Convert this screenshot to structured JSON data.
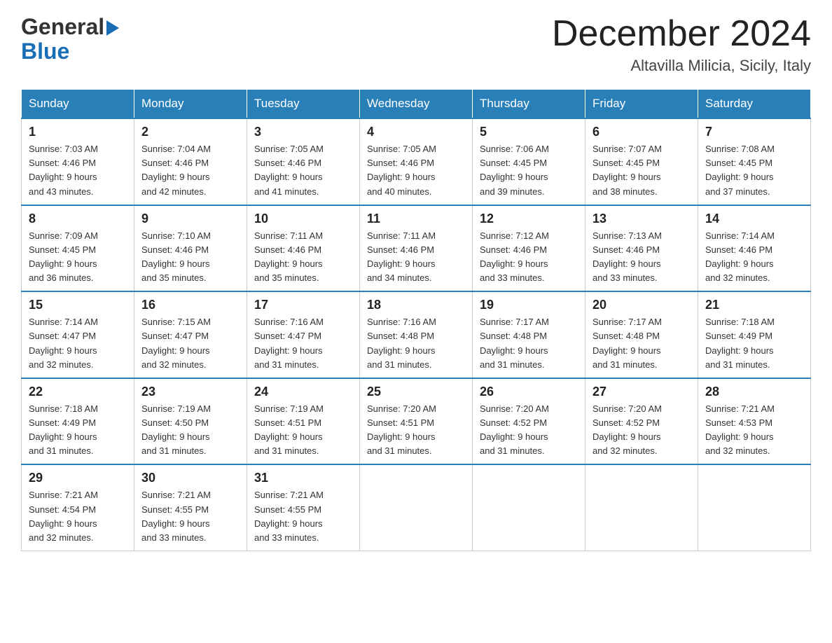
{
  "header": {
    "logo_general": "General",
    "logo_blue": "Blue",
    "month_title": "December 2024",
    "location": "Altavilla Milicia, Sicily, Italy"
  },
  "days_of_week": [
    "Sunday",
    "Monday",
    "Tuesday",
    "Wednesday",
    "Thursday",
    "Friday",
    "Saturday"
  ],
  "weeks": [
    [
      {
        "day": "1",
        "sunrise": "7:03 AM",
        "sunset": "4:46 PM",
        "daylight": "9 hours and 43 minutes."
      },
      {
        "day": "2",
        "sunrise": "7:04 AM",
        "sunset": "4:46 PM",
        "daylight": "9 hours and 42 minutes."
      },
      {
        "day": "3",
        "sunrise": "7:05 AM",
        "sunset": "4:46 PM",
        "daylight": "9 hours and 41 minutes."
      },
      {
        "day": "4",
        "sunrise": "7:05 AM",
        "sunset": "4:46 PM",
        "daylight": "9 hours and 40 minutes."
      },
      {
        "day": "5",
        "sunrise": "7:06 AM",
        "sunset": "4:45 PM",
        "daylight": "9 hours and 39 minutes."
      },
      {
        "day": "6",
        "sunrise": "7:07 AM",
        "sunset": "4:45 PM",
        "daylight": "9 hours and 38 minutes."
      },
      {
        "day": "7",
        "sunrise": "7:08 AM",
        "sunset": "4:45 PM",
        "daylight": "9 hours and 37 minutes."
      }
    ],
    [
      {
        "day": "8",
        "sunrise": "7:09 AM",
        "sunset": "4:45 PM",
        "daylight": "9 hours and 36 minutes."
      },
      {
        "day": "9",
        "sunrise": "7:10 AM",
        "sunset": "4:46 PM",
        "daylight": "9 hours and 35 minutes."
      },
      {
        "day": "10",
        "sunrise": "7:11 AM",
        "sunset": "4:46 PM",
        "daylight": "9 hours and 35 minutes."
      },
      {
        "day": "11",
        "sunrise": "7:11 AM",
        "sunset": "4:46 PM",
        "daylight": "9 hours and 34 minutes."
      },
      {
        "day": "12",
        "sunrise": "7:12 AM",
        "sunset": "4:46 PM",
        "daylight": "9 hours and 33 minutes."
      },
      {
        "day": "13",
        "sunrise": "7:13 AM",
        "sunset": "4:46 PM",
        "daylight": "9 hours and 33 minutes."
      },
      {
        "day": "14",
        "sunrise": "7:14 AM",
        "sunset": "4:46 PM",
        "daylight": "9 hours and 32 minutes."
      }
    ],
    [
      {
        "day": "15",
        "sunrise": "7:14 AM",
        "sunset": "4:47 PM",
        "daylight": "9 hours and 32 minutes."
      },
      {
        "day": "16",
        "sunrise": "7:15 AM",
        "sunset": "4:47 PM",
        "daylight": "9 hours and 32 minutes."
      },
      {
        "day": "17",
        "sunrise": "7:16 AM",
        "sunset": "4:47 PM",
        "daylight": "9 hours and 31 minutes."
      },
      {
        "day": "18",
        "sunrise": "7:16 AM",
        "sunset": "4:48 PM",
        "daylight": "9 hours and 31 minutes."
      },
      {
        "day": "19",
        "sunrise": "7:17 AM",
        "sunset": "4:48 PM",
        "daylight": "9 hours and 31 minutes."
      },
      {
        "day": "20",
        "sunrise": "7:17 AM",
        "sunset": "4:48 PM",
        "daylight": "9 hours and 31 minutes."
      },
      {
        "day": "21",
        "sunrise": "7:18 AM",
        "sunset": "4:49 PM",
        "daylight": "9 hours and 31 minutes."
      }
    ],
    [
      {
        "day": "22",
        "sunrise": "7:18 AM",
        "sunset": "4:49 PM",
        "daylight": "9 hours and 31 minutes."
      },
      {
        "day": "23",
        "sunrise": "7:19 AM",
        "sunset": "4:50 PM",
        "daylight": "9 hours and 31 minutes."
      },
      {
        "day": "24",
        "sunrise": "7:19 AM",
        "sunset": "4:51 PM",
        "daylight": "9 hours and 31 minutes."
      },
      {
        "day": "25",
        "sunrise": "7:20 AM",
        "sunset": "4:51 PM",
        "daylight": "9 hours and 31 minutes."
      },
      {
        "day": "26",
        "sunrise": "7:20 AM",
        "sunset": "4:52 PM",
        "daylight": "9 hours and 31 minutes."
      },
      {
        "day": "27",
        "sunrise": "7:20 AM",
        "sunset": "4:52 PM",
        "daylight": "9 hours and 32 minutes."
      },
      {
        "day": "28",
        "sunrise": "7:21 AM",
        "sunset": "4:53 PM",
        "daylight": "9 hours and 32 minutes."
      }
    ],
    [
      {
        "day": "29",
        "sunrise": "7:21 AM",
        "sunset": "4:54 PM",
        "daylight": "9 hours and 32 minutes."
      },
      {
        "day": "30",
        "sunrise": "7:21 AM",
        "sunset": "4:55 PM",
        "daylight": "9 hours and 33 minutes."
      },
      {
        "day": "31",
        "sunrise": "7:21 AM",
        "sunset": "4:55 PM",
        "daylight": "9 hours and 33 minutes."
      },
      null,
      null,
      null,
      null
    ]
  ],
  "labels": {
    "sunrise": "Sunrise:",
    "sunset": "Sunset:",
    "daylight": "Daylight:"
  }
}
